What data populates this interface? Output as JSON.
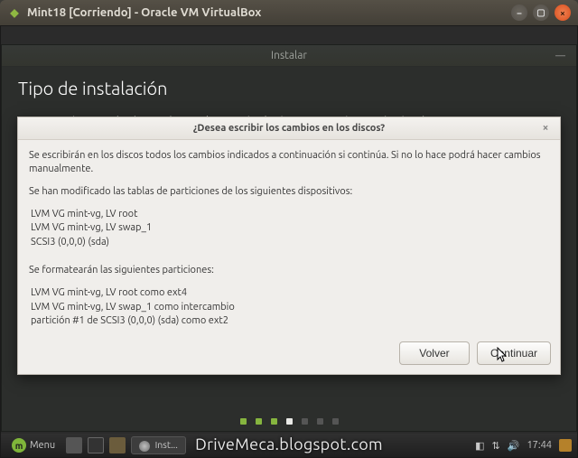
{
  "vbox": {
    "title": "Mint18 [Corriendo] - Oracle VM VirtualBox"
  },
  "installer": {
    "window_title": "Instalar",
    "heading": "Tipo de instalación",
    "subtext": "En este equipo no se ha detectado actualmente ningún sistema operativo. ¿Qué quiere hacer?"
  },
  "modal": {
    "title": "¿Desea escribir los cambios en los discos?",
    "intro": "Se escribirán en los discos todos los cambios indicados a continuación si continúa. Si no lo hace podrá hacer cambios manualmente.",
    "changed_label": "Se han modificado las tablas de particiones de los siguientes dispositivos:",
    "changed": [
      "LVM VG mint-vg, LV root",
      "LVM VG mint-vg, LV swap_1",
      "SCSI3 (0,0,0) (sda)"
    ],
    "format_label": "Se formatearán las siguientes particiones:",
    "format": [
      "LVM VG mint-vg, LV root como ext4",
      "LVM VG mint-vg, LV swap_1 como intercambio",
      "partición #1 de SCSI3 (0,0,0) (sda) como ext2"
    ],
    "back": "Volver",
    "continue": "Continuar"
  },
  "taskbar": {
    "menu": "Menu",
    "running": "Inst...",
    "time": "17:44"
  },
  "watermark": "DriveMeca.blogspot.com"
}
